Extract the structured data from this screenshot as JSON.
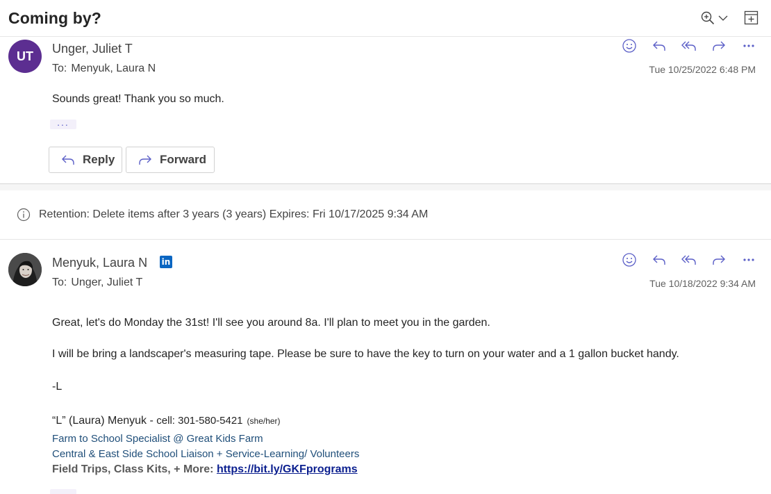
{
  "header": {
    "subject": "Coming by?",
    "zoom_icon": "zoom-in-icon",
    "expand_icon": "open-in-new-window-icon"
  },
  "messages": [
    {
      "avatar_initials": "UT",
      "avatar_color": "#5c2e91",
      "sender": "Unger, Juliet T",
      "to_label": "To:",
      "to": "Menyuk, Laura N",
      "date": "Tue 10/25/2022 6:48 PM",
      "body": [
        "Sounds great! Thank you so much."
      ],
      "reply_label": "Reply",
      "forward_label": "Forward"
    },
    {
      "sender": "Menyuk, Laura N",
      "linkedin_badge": "in",
      "to_label": "To:",
      "to": "Unger, Juliet T",
      "date": "Tue 10/18/2022 9:34 AM",
      "body": [
        "Great, let's do Monday the 31st! I'll see you around 8a. I'll plan to meet you in the garden.",
        "I will be bring a landscaper's measuring tape. Please be sure to have the key to turn on your water and a 1 gallon bucket handy.",
        "-L"
      ],
      "signature": {
        "name": "“L” (Laura) Menyuk - ",
        "cell": "cell: 301-580-5421",
        "pronouns": "(she/her)",
        "title": "Farm to School Specialist @ Great Kids Farm",
        "role": "Central & East Side School Liaison +  Service-Learning/ Volunteers",
        "more_label": "Field Trips, Class Kits, + More: ",
        "more_link": "https://bit.ly/GKFprograms"
      }
    }
  ],
  "retention": {
    "text": "Retention: Delete items after 3 years (3 years) Expires: Fri 10/17/2025 9:34 AM"
  },
  "colors": {
    "accent": "#5b5fc7",
    "link_blue": "#1f4e79"
  }
}
